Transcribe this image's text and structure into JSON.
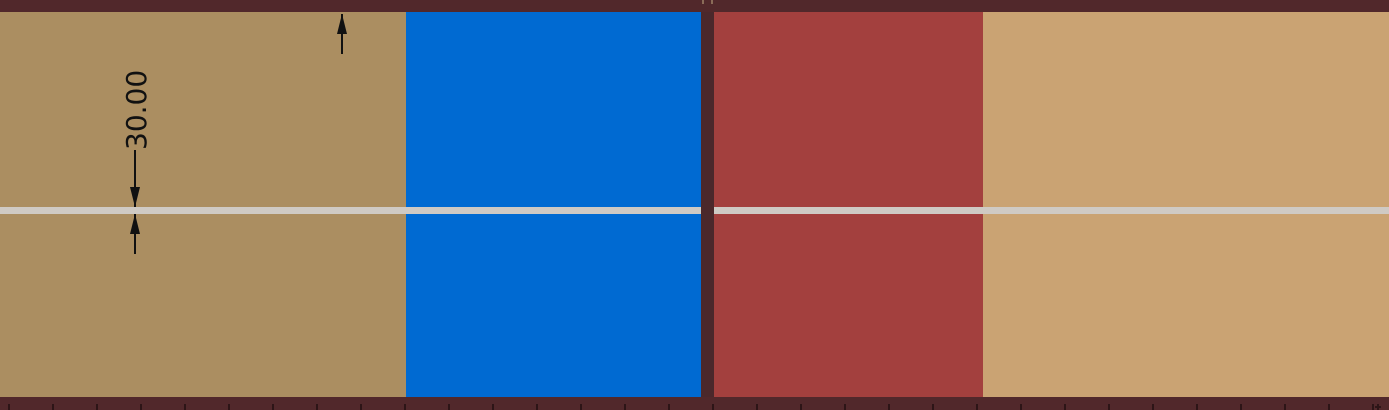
{
  "drawing": {
    "dimension_value": "30.00",
    "colors": {
      "frame": "#51282b",
      "panel_tan": "#ab8e61",
      "panel_blue": "#006ad2",
      "panel_red": "#a3403e",
      "panel_peach": "#caa373",
      "centerline": "#cfcac4",
      "dimension": "#111111"
    },
    "icons": [
      "dimension-arrow-up-icon",
      "dimension-arrow-down-icon",
      "dimension-arrow-up-icon"
    ]
  }
}
